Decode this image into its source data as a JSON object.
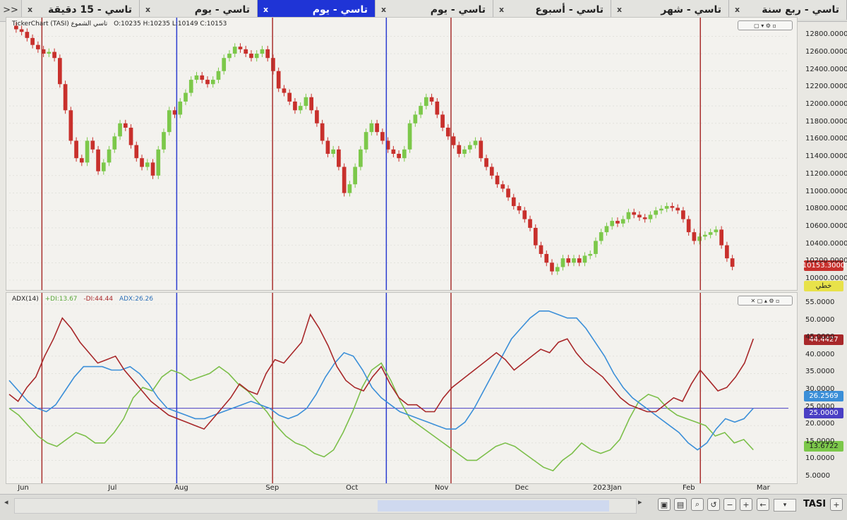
{
  "tabs": {
    "more": ">>",
    "close_symbol": "x",
    "items": [
      {
        "label": "تاسي - 15 دقيقة",
        "active": false
      },
      {
        "label": "تاسي - يوم",
        "active": false
      },
      {
        "label": "تاسي - يوم",
        "active": true
      },
      {
        "label": "تاسي - يوم",
        "active": false
      },
      {
        "label": "تاسي - أسبوع",
        "active": false
      },
      {
        "label": "تاسي - شهر",
        "active": false
      },
      {
        "label": "تاسي - ربع سنة",
        "active": false
      }
    ]
  },
  "price_pane": {
    "title": "TickerChart (TASI) تاسي الشموع",
    "ohlc": "O:10235 H:10235 L:10149 C:10153",
    "last_price": "10153.3000",
    "style_badge": "خطي",
    "controls": "▢ ▾ ⚙ ▫"
  },
  "adx_pane": {
    "title": "ADX(14)",
    "plus_di": "+DI:13.67",
    "minus_di": "-DI:44.44",
    "adx": "ADX:26.26",
    "controls": "✕ ▢ ▴ ⚙ ▫",
    "badges": {
      "minus_di": "44.4427",
      "adx": "26.2569",
      "level": "25.0000",
      "plus_di": "13.6722"
    }
  },
  "colors": {
    "up": "#7cc84a",
    "down": "#c8302c",
    "adx": "#3b8fd8",
    "minus_di": "#a8282a",
    "plus_di": "#7cbf4a",
    "level": "#4a3fc4",
    "vline_red": "#a8302e",
    "vline_blue": "#2b3dd0"
  },
  "x_labels": [
    "Jun",
    "Jul",
    "Aug",
    "Sep",
    "Oct",
    "Nov",
    "Dec",
    "2023Jan",
    "Feb",
    "Mar"
  ],
  "price_ticks": [
    "12800.0000",
    "12600.0000",
    "12400.0000",
    "12200.0000",
    "12000.0000",
    "11800.0000",
    "11600.0000",
    "11400.0000",
    "11200.0000",
    "11000.0000",
    "10800.0000",
    "10600.0000",
    "10400.0000",
    "10200.0000",
    "10000.0000"
  ],
  "adx_ticks": [
    "55.0000",
    "50.0000",
    "45.0000",
    "40.0000",
    "35.0000",
    "30.0000",
    "25.0000",
    "20.0000",
    "15.0000",
    "10.0000",
    "5.0000"
  ],
  "toolbar": {
    "symbol": "TASI",
    "icons": [
      "chart-icon",
      "layout-icon",
      "zoom-region-icon",
      "undo-zoom-icon",
      "zoom-out-icon",
      "zoom-in-icon",
      "back-icon"
    ]
  },
  "chart_data": [
    {
      "type": "candlestick",
      "title": "TickerChart (TASI) تاسي الشموع",
      "x": [
        "Jun",
        "Jul",
        "Aug",
        "Sep",
        "Oct",
        "Nov",
        "Dec",
        "2023Jan",
        "Feb",
        "Mar"
      ],
      "ylim": [
        10000,
        12900
      ],
      "close_series": [
        12880,
        12850,
        12780,
        12700,
        12650,
        12600,
        12620,
        12550,
        12250,
        11950,
        11600,
        11400,
        11350,
        11600,
        11500,
        11250,
        11350,
        11500,
        11650,
        11800,
        11750,
        11550,
        11400,
        11300,
        11350,
        11200,
        11500,
        11700,
        11950,
        11900,
        12050,
        12150,
        12300,
        12350,
        12300,
        12250,
        12300,
        12400,
        12550,
        12600,
        12680,
        12650,
        12600,
        12550,
        12600,
        12650,
        12550,
        12400,
        12200,
        12150,
        12050,
        11950,
        12000,
        12100,
        11950,
        11800,
        11600,
        11450,
        11500,
        11300,
        11000,
        11100,
        11300,
        11500,
        11700,
        11800,
        11700,
        11600,
        11500,
        11450,
        11400,
        11500,
        11800,
        11900,
        12000,
        12100,
        12050,
        11900,
        11750,
        11650,
        11550,
        11450,
        11500,
        11550,
        11600,
        11400,
        11300,
        11200,
        11100,
        11050,
        10950,
        10850,
        10800,
        10700,
        10600,
        10400,
        10300,
        10200,
        10100,
        10150,
        10250,
        10200,
        10250,
        10200,
        10280,
        10300,
        10450,
        10550,
        10620,
        10680,
        10650,
        10700,
        10780,
        10750,
        10720,
        10700,
        10750,
        10800,
        10820,
        10850,
        10830,
        10800,
        10700,
        10550,
        10450,
        10500,
        10520,
        10550,
        10580,
        10400,
        10250,
        10153
      ],
      "adx": [
        33,
        30,
        27,
        25,
        24,
        26,
        30,
        34,
        37,
        37,
        37,
        36,
        36,
        37,
        35,
        32,
        28,
        25,
        24,
        23,
        22,
        22,
        23,
        24,
        25,
        26,
        27,
        26,
        25,
        23,
        22,
        23,
        25,
        29,
        34,
        38,
        41,
        40,
        36,
        31,
        28,
        26,
        24,
        23,
        22,
        21,
        20,
        19,
        19,
        21,
        25,
        30,
        35,
        40,
        45,
        48,
        51,
        53,
        53,
        52,
        51,
        51,
        48,
        44,
        40,
        35,
        31,
        28,
        26,
        24,
        22,
        20,
        18,
        15,
        13,
        15,
        19,
        22,
        21,
        22,
        25
      ],
      "minus_di": [
        29,
        27,
        31,
        34,
        40,
        45,
        51,
        48,
        44,
        41,
        38,
        39,
        40,
        36,
        33,
        30,
        27,
        25,
        23,
        22,
        21,
        20,
        19,
        22,
        25,
        28,
        32,
        30,
        29,
        35,
        39,
        38,
        41,
        44,
        52,
        48,
        43,
        37,
        33,
        31,
        30,
        34,
        37,
        32,
        28,
        26,
        26,
        24,
        24,
        28,
        31,
        33,
        35,
        37,
        39,
        41,
        39,
        36,
        38,
        40,
        42,
        41,
        44,
        45,
        41,
        38,
        36,
        34,
        31,
        28,
        26,
        25,
        24,
        24,
        26,
        28,
        27,
        32,
        36,
        33,
        30,
        31,
        34,
        38,
        45
      ],
      "plus_di": [
        25,
        23,
        20,
        17,
        15,
        14,
        16,
        18,
        17,
        15,
        15,
        18,
        22,
        28,
        31,
        30,
        34,
        36,
        35,
        33,
        34,
        35,
        37,
        35,
        32,
        30,
        27,
        24,
        20,
        17,
        15,
        14,
        12,
        11,
        13,
        18,
        24,
        31,
        36,
        38,
        33,
        27,
        22,
        20,
        18,
        16,
        14,
        12,
        10,
        10,
        12,
        14,
        15,
        14,
        12,
        10,
        8,
        7,
        10,
        12,
        15,
        13,
        12,
        13,
        16,
        22,
        27,
        29,
        28,
        25,
        23,
        22,
        21,
        20,
        17,
        18,
        15,
        16,
        13
      ]
    }
  ]
}
